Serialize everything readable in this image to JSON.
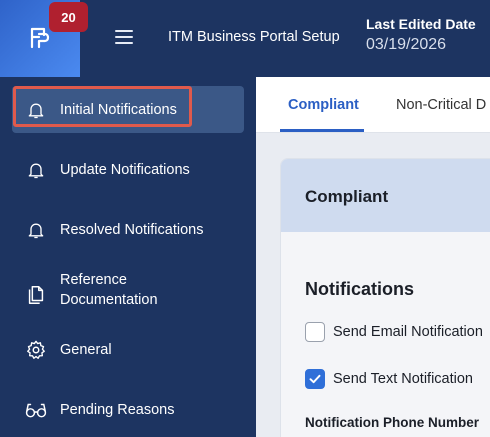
{
  "header": {
    "notification_count": "20",
    "app_title": "ITM Business Portal Setup",
    "last_edited_label": "Last Edited Date",
    "last_edited_date": "03/19/2026",
    "logo_icon": "portal-logo-icon",
    "menu_icon": "hamburger-menu-icon"
  },
  "sidebar": {
    "items": [
      {
        "label": "Initial Notifications",
        "icon": "bell-icon",
        "active": true
      },
      {
        "label": "Update Notifications",
        "icon": "bell-icon",
        "active": false
      },
      {
        "label": "Resolved Notifications",
        "icon": "bell-icon",
        "active": false
      },
      {
        "label_line1": "Reference",
        "label_line2": "Documentation",
        "icon": "documents-icon",
        "active": false
      },
      {
        "label": "General",
        "icon": "gear-icon",
        "active": false
      },
      {
        "label": "Pending Reasons",
        "icon": "glasses-icon",
        "active": false
      }
    ]
  },
  "tabs": [
    {
      "label": "Compliant",
      "active": true
    },
    {
      "label": "Non-Critical D",
      "active": false
    }
  ],
  "card": {
    "title": "Compliant",
    "section_title": "Notifications",
    "options": [
      {
        "label": "Send Email Notification",
        "checked": false
      },
      {
        "label": "Send Text Notification",
        "checked": true
      }
    ],
    "phone_label": "Notification Phone Number"
  },
  "colors": {
    "nav_bg": "#1d3461",
    "accent": "#2b5fc4",
    "badge": "#b0202f",
    "highlight": "#e05a4c"
  }
}
